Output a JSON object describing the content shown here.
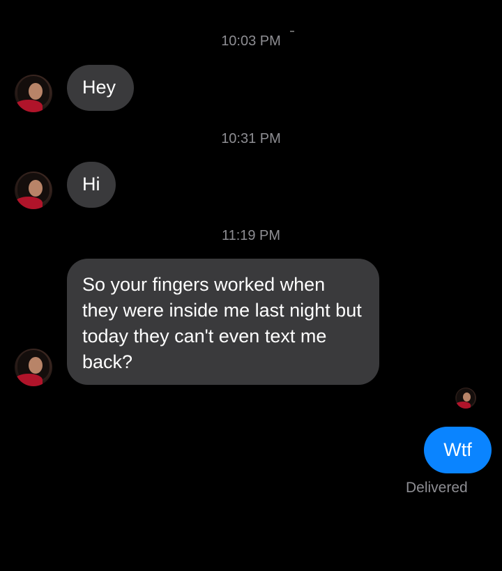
{
  "conversation": {
    "timestamp_1": "10:03 PM",
    "message_1": "Hey",
    "timestamp_2": "10:31 PM",
    "message_2": "Hi",
    "timestamp_3": "11:19 PM",
    "message_3": "So your fingers worked when they were inside me last night but today they can't even text me back?",
    "sent_message": "Wtf",
    "sent_status": "Delivered"
  },
  "colors": {
    "background": "#000000",
    "incoming_bubble": "#3a3a3c",
    "outgoing_bubble": "#0a84ff",
    "timestamp_text": "#8e8e93"
  },
  "icons": {
    "contact_avatar": "avatar",
    "seen_avatar": "avatar"
  }
}
